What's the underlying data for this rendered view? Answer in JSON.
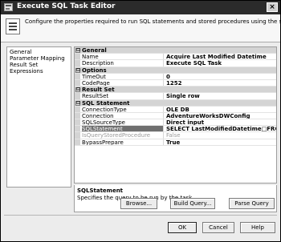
{
  "window": {
    "title": "Execute SQL Task Editor",
    "close_label": "×",
    "description": "Configure the properties required to run SQL statements and stored procedures using the selected connection."
  },
  "nav": {
    "items": [
      {
        "label": "General"
      },
      {
        "label": "Parameter Mapping"
      },
      {
        "label": "Result Set"
      },
      {
        "label": "Expressions"
      }
    ]
  },
  "properties": {
    "toggle": "⊟",
    "general": {
      "category": "General",
      "name_label": "Name",
      "name_value": "Acquire Last Modified Datetime",
      "description_label": "Description",
      "description_value": "Execute SQL Task"
    },
    "options": {
      "category": "Options",
      "timeout_label": "TimeOut",
      "timeout_value": "0",
      "codepage_label": "CodePage",
      "codepage_value": "1252"
    },
    "result_set": {
      "category": "Result Set",
      "resultset_label": "ResultSet",
      "resultset_value": "Single row"
    },
    "sql_statement": {
      "category": "SQL Statement",
      "connectiontype_label": "ConnectionType",
      "connectiontype_value": "OLE DB",
      "connection_label": "Connection",
      "connection_value": "AdventureWorksDWConfig",
      "sqlsourcetype_label": "SQLSourceType",
      "sqlsourcetype_value": "Direct input",
      "sqlstatement_label": "SQLStatement",
      "sqlstatement_value": "SELECT LastModifiedDatetime□FROM cfgIncrementa",
      "isquerystoredprocedure_label": "IsQueryStoredProcedure",
      "isquerystoredprocedure_value": "False",
      "bypassprepare_label": "BypassPrepare",
      "bypassprepare_value": "True"
    }
  },
  "help_panel": {
    "title": "SQLStatement",
    "text": "Specifies the query to be run by the task."
  },
  "buttons": {
    "browse": "Browse...",
    "build_query": "Build Query...",
    "parse_query": "Parse Query",
    "ok": "OK",
    "cancel": "Cancel",
    "help": "Help"
  }
}
